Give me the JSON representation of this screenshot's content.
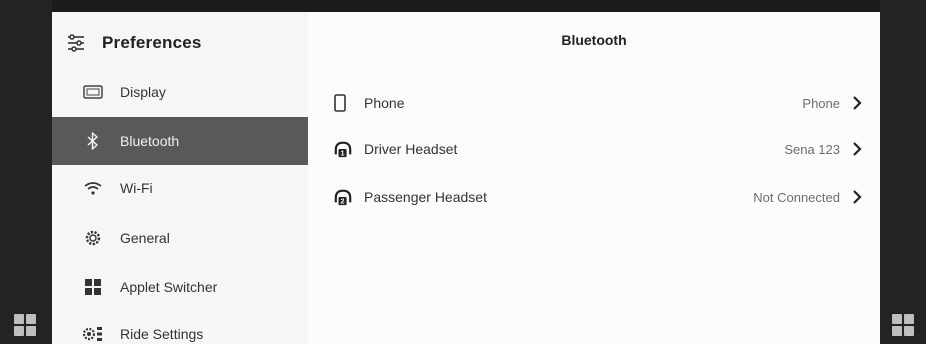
{
  "sidebar": {
    "title": "Preferences",
    "items": [
      {
        "label": "Display",
        "icon": "display-icon"
      },
      {
        "label": "Bluetooth",
        "icon": "bluetooth-icon",
        "active": true
      },
      {
        "label": "Wi-Fi",
        "icon": "wifi-icon"
      },
      {
        "label": "General",
        "icon": "gear-icon"
      },
      {
        "label": "Applet Switcher",
        "icon": "applet-grid-icon"
      },
      {
        "label": "Ride Settings",
        "icon": "ride-settings-icon"
      }
    ]
  },
  "main": {
    "title": "Bluetooth",
    "rows": [
      {
        "label": "Phone",
        "value": "Phone",
        "icon": "phone-icon"
      },
      {
        "label": "Driver Headset",
        "value": "Sena 123",
        "icon": "headset-1-icon"
      },
      {
        "label": "Passenger Headset",
        "value": "Not Connected",
        "icon": "headset-2-icon"
      }
    ]
  },
  "colors": {
    "panel": "#fbfbfb",
    "sidebar": "#f6f6f6",
    "active_item": "#595959",
    "frame": "#232323"
  }
}
